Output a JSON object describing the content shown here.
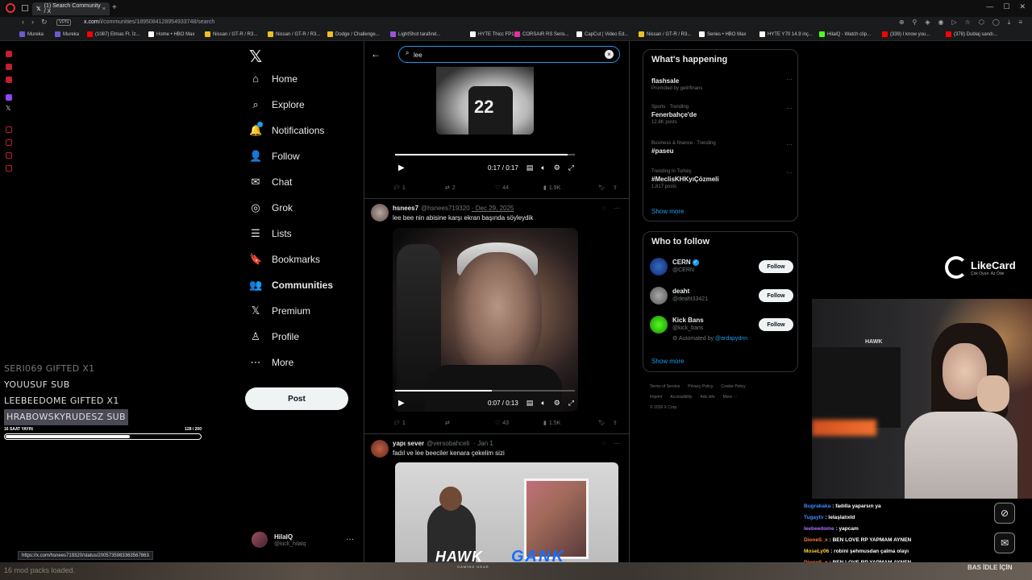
{
  "browser": {
    "tab_title": "(1) Search Community / X",
    "url_prefix": "x.com",
    "url_path": "/i/communities/1895084128954933748/search",
    "vpn_label": "VPN",
    "bookmarks": [
      {
        "label": "Mureka",
        "color": "#6a5acd"
      },
      {
        "label": "Mureka",
        "color": "#6a5acd"
      },
      {
        "label": "(1087) Elmas Ft. İz...",
        "color": "#ff0000"
      },
      {
        "label": "Home • HBO Max",
        "color": "#ffffff"
      },
      {
        "label": "Nissan / GT-R / R3...",
        "color": "#f0c020"
      },
      {
        "label": "Nissan / GT-R / R3...",
        "color": "#f0c020"
      },
      {
        "label": "Dodge / Challenge...",
        "color": "#f0c020"
      },
      {
        "label": "LightShot tarafınd...",
        "color": "#a050e0"
      },
      {
        "label": "HYTE Thicc FP12...",
        "color": "#ffffff"
      },
      {
        "label": "CORSAIR RS Seris...",
        "color": "#e030a0"
      },
      {
        "label": "CapCut | Video Ed...",
        "color": "#ffffff"
      },
      {
        "label": "Nissan / GT-R / R3...",
        "color": "#f0c020"
      },
      {
        "label": "Series • HBO Max",
        "color": "#ffffff"
      },
      {
        "label": "HYTE Y70 14.9 inç...",
        "color": "#ffffff"
      },
      {
        "label": "HilalQ - Watch clip...",
        "color": "#53fc18"
      },
      {
        "label": "(339) I know you...",
        "color": "#ff0000"
      },
      {
        "label": "(378) Dublaj sandı...",
        "color": "#ff0000"
      }
    ],
    "status_url": "https://x.com/hsnees719320/status/2005735983363567863"
  },
  "x_nav": {
    "items": [
      {
        "key": "home",
        "label": "Home",
        "icon": "⌂",
        "active": false
      },
      {
        "key": "explore",
        "label": "Explore",
        "icon": "⌕",
        "active": false
      },
      {
        "key": "notifications",
        "label": "Notifications",
        "icon": "🔔",
        "active": false
      },
      {
        "key": "follow",
        "label": "Follow",
        "icon": "👤",
        "active": false
      },
      {
        "key": "chat",
        "label": "Chat",
        "icon": "✉",
        "active": false
      },
      {
        "key": "grok",
        "label": "Grok",
        "icon": "◎",
        "active": false
      },
      {
        "key": "lists",
        "label": "Lists",
        "icon": "☰",
        "active": false
      },
      {
        "key": "bookmarks",
        "label": "Bookmarks",
        "icon": "🔖",
        "active": false
      },
      {
        "key": "communities",
        "label": "Communities",
        "icon": "👥",
        "active": true
      },
      {
        "key": "premium",
        "label": "Premium",
        "icon": "𝕏",
        "active": false
      },
      {
        "key": "profile",
        "label": "Profile",
        "icon": "♙",
        "active": false
      },
      {
        "key": "more",
        "label": "More",
        "icon": "⋯",
        "active": false
      }
    ],
    "post_label": "Post",
    "account_name": "HilalQ",
    "account_handle": "@kick_hilalq",
    "more_dots": "···"
  },
  "search": {
    "value": "lee",
    "clear": "×"
  },
  "tweet1": {
    "jersey_number": "22",
    "time": "0:17 / 0:17",
    "replies": "1",
    "reposts": "2",
    "likes": "44",
    "views": "1.9K"
  },
  "tweet2": {
    "name": "hsnees7",
    "handle": "@hsnees719320",
    "date": "· Dec 29, 2025",
    "text": "lee bee nin abisine karşı ekran başında söyleydik",
    "time": "0:07 / 0:13",
    "replies": "1",
    "reposts": "",
    "likes": "43",
    "views": "1.5K"
  },
  "tweet3": {
    "name": "yapı sever",
    "handle": "@versobahceli",
    "date": "· Jan 1",
    "text": "fadıl ve lee beeciler kenara çekelim sizi"
  },
  "whats_happening": {
    "title": "What's happening",
    "trends": [
      {
        "meta": "",
        "name": "flashsale",
        "sub": "Promoted by getirfinans"
      },
      {
        "meta": "Sports · Trending",
        "name": "Fenerbahçe'de",
        "sub": "12.8K posts"
      },
      {
        "meta": "Business & finance · Trending",
        "name": "#paseu",
        "sub": ""
      },
      {
        "meta": "Trending in Turkey",
        "name": "#MeclisKHKyıÇözmeli",
        "sub": "1,817 posts"
      }
    ],
    "show_more": "Show more"
  },
  "who_to_follow": {
    "title": "Who to follow",
    "people": [
      {
        "name": "CERN",
        "handle": "@CERN",
        "verified": true,
        "auto": "",
        "auto_by": ""
      },
      {
        "name": "deaht",
        "handle": "@deaht33421",
        "verified": false,
        "auto": "",
        "auto_by": ""
      },
      {
        "name": "Kick Bans",
        "handle": "@kick_bans",
        "verified": false,
        "auto": "Automated by",
        "auto_by": "@ardapydnn"
      }
    ],
    "follow_label": "Follow",
    "show_more": "Show more"
  },
  "footer": {
    "links": [
      "Terms of Service",
      "Privacy Policy",
      "Cookie Policy",
      "Imprint",
      "Accessibility",
      "Ads info",
      "More ···"
    ],
    "copyright": "© 2026 X Corp."
  },
  "stream": {
    "subs": [
      {
        "text": "SERI069  GIFTED X1",
        "style": "faded"
      },
      {
        "text": "YOUUSUF  SUB",
        "style": "normal"
      },
      {
        "text": "LEEBEEDOME  GIFTED X1",
        "style": "normal"
      },
      {
        "text": "HRABOWSKYRUDESZ  SUB",
        "style": "hl"
      }
    ],
    "timer_label": "16 SAAT YAYIN",
    "timer_count": "128  / 200",
    "timer_progress": 0.64,
    "likecard_title": "LikeCard",
    "likecard_sub": "Çok Oyun. Az Öde",
    "cam_brand": "HAWK",
    "chat": [
      {
        "user": "Bugrakaka",
        "color": "#3a8fff",
        "msg": ": fadılla yaparsın ya"
      },
      {
        "user": "Tugaytv",
        "color": "#3a8fff",
        "msg": ": lelaşlalıxld"
      },
      {
        "user": "leebeedome",
        "color": "#b070ff",
        "msg": ": yapcam"
      },
      {
        "user": "DioneS_x",
        "color": "#ff7a3a",
        "msg": ": BEN LOVE RP YAPMAM AYNEN"
      },
      {
        "user": "MoseLy06",
        "color": "#ffd23a",
        "msg": ": robini şehmusdan çalma olayı"
      },
      {
        "user": "DioneS_x",
        "color": "#ff7a3a",
        "msg": ": BEN LOVE RP YAPMAM AYNEN"
      }
    ],
    "mod_packs": "16 mod packs loaded.",
    "idle": "BAS  İDLE İÇİN",
    "sponsor_hawk": "HAWK",
    "sponsor_hawk_sub": "GAMING GEAR",
    "sponsor_gank": "GANK"
  }
}
